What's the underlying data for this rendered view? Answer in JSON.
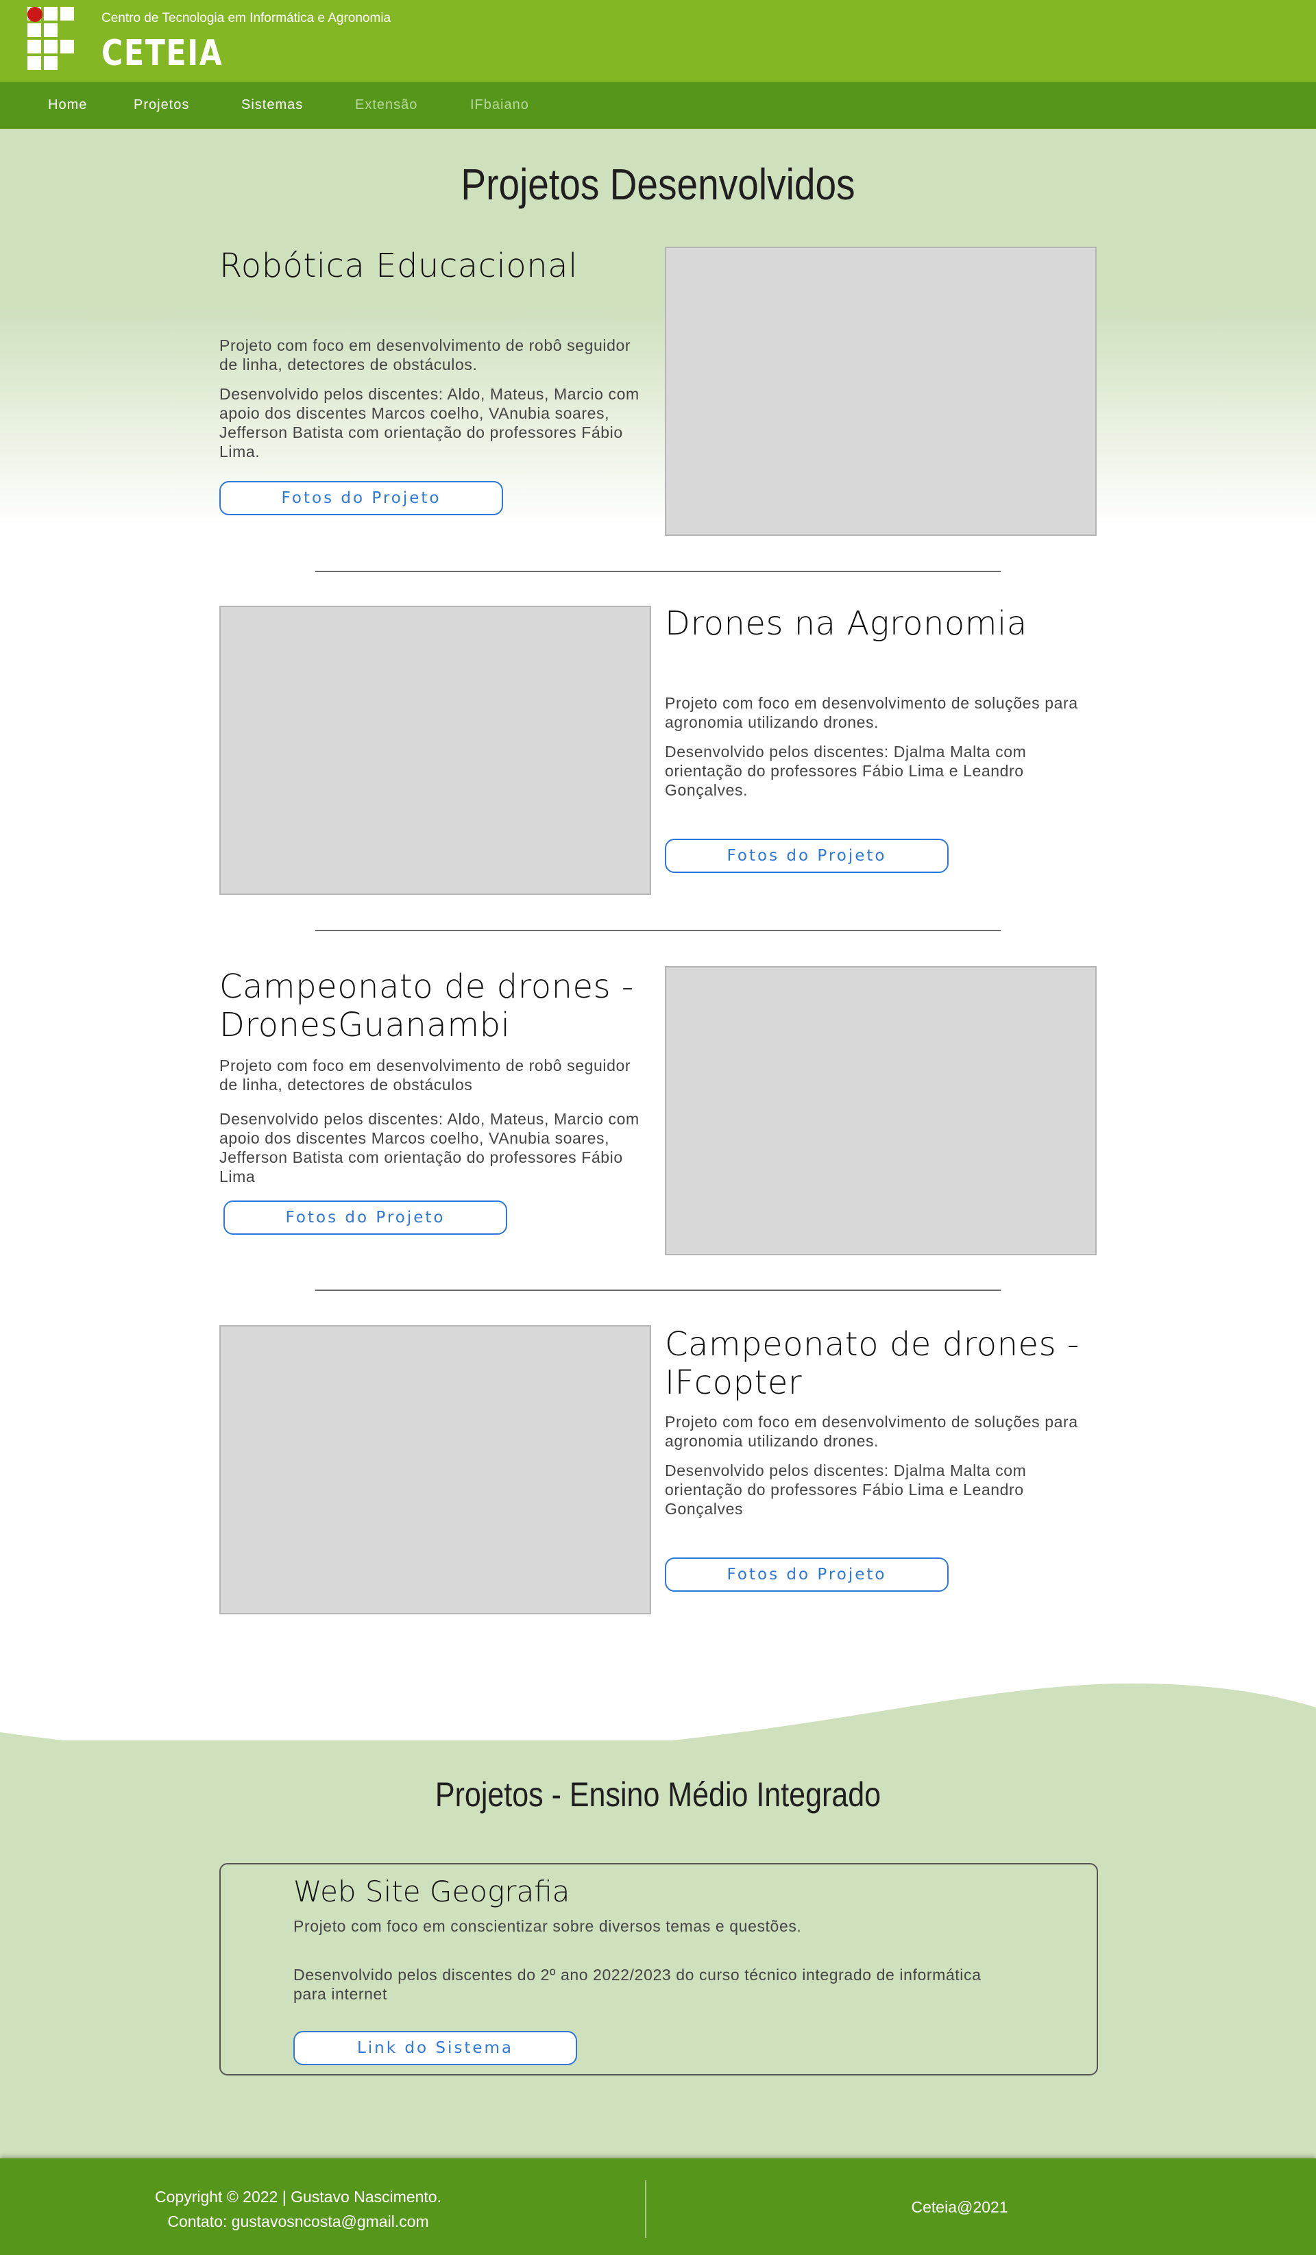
{
  "header": {
    "tagline": "Centro de Tecnologia em Informática e Agronomia",
    "brand": "CETEIA"
  },
  "nav": {
    "items": [
      {
        "label": "Home"
      },
      {
        "label": "Projetos"
      },
      {
        "label": "Sistemas"
      },
      {
        "label": "Extensão"
      },
      {
        "label": "IFbaiano"
      }
    ]
  },
  "main": {
    "title": "Projetos Desenvolvidos",
    "projects": [
      {
        "title": "Robótica Educacional",
        "desc": "Projeto com foco em desenvolvimento de robô seguidor de linha, detectores de obstáculos.",
        "credits": "Desenvolvido pelos discentes: Aldo, Mateus, Marcio com apoio dos discentes Marcos coelho, VAnubia soares, Jefferson Batista com orientação do professores Fábio Lima.",
        "button": "Fotos do Projeto"
      },
      {
        "title": "Drones na Agronomia",
        "desc": "Projeto com foco em desenvolvimento de soluções para agronomia utilizando drones.",
        "credits": "Desenvolvido pelos discentes: Djalma Malta com orientação do professores Fábio Lima e Leandro Gonçalves.",
        "button": "Fotos do Projeto"
      },
      {
        "title": "Campeonato de drones - DronesGuanambi",
        "desc": "Projeto com foco em desenvolvimento de robô seguidor de linha, detectores de obstáculos",
        "credits": "Desenvolvido pelos discentes: Aldo, Mateus, Marcio com apoio dos discentes Marcos coelho, VAnubia soares, Jefferson Batista com orientação do professores Fábio Lima",
        "button": "Fotos do Projeto"
      },
      {
        "title": "Campeonato de drones - IFcopter",
        "desc": "Projeto com foco em desenvolvimento de soluções para agronomia utilizando drones.",
        "credits": "Desenvolvido pelos discentes: Djalma Malta com orientação do professores Fábio Lima e Leandro Gonçalves",
        "button": "Fotos do Projeto"
      }
    ]
  },
  "ensino": {
    "title": "Projetos - Ensino Médio Integrado",
    "card": {
      "title": "Web Site Geografia",
      "desc": "Projeto com foco em conscientizar sobre diversos temas e questões.",
      "credits": "Desenvolvido pelos discentes do 2º ano 2022/2023 do curso técnico integrado de informática para internet",
      "button": "Link do Sistema"
    }
  },
  "footer": {
    "copyright": "Copyright © 2022 | Gustavo Nascimento.",
    "contact": "Contato: gustavosncosta@gmail.com",
    "right": "Ceteia@2021"
  },
  "colors": {
    "header_green": "#83b723",
    "nav_green": "#55961b",
    "light_green": "#cfe0bd",
    "button_blue": "#2f78d9",
    "logo_red": "#cc1717"
  }
}
